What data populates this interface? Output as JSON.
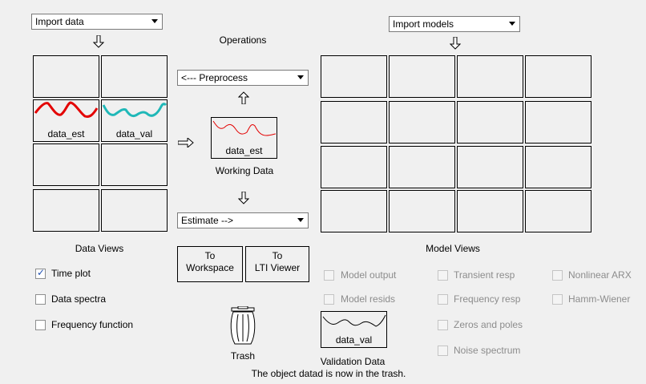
{
  "import_data": {
    "selected": "Import data"
  },
  "import_models": {
    "selected": "Import models"
  },
  "operations": {
    "title": "Operations",
    "preprocess": "<--- Preprocess",
    "estimate": "Estimate -->"
  },
  "data_boards": {
    "slot_estimation": "data_est",
    "slot_validation": "data_val",
    "caption": "Data Views"
  },
  "working_data": {
    "label": "data_est",
    "caption": "Working Data"
  },
  "buttons": {
    "to_workspace": [
      "To",
      "Workspace"
    ],
    "to_lti": [
      "To",
      "LTI Viewer"
    ]
  },
  "data_views": [
    {
      "label": "Time plot",
      "checked": true
    },
    {
      "label": "Data spectra",
      "checked": false
    },
    {
      "label": "Frequency function",
      "checked": false
    }
  ],
  "model_views": {
    "caption": "Model Views",
    "items": [
      "Model output",
      "Transient resp",
      "Nonlinear ARX",
      "Model resids",
      "Frequency resp",
      "Hamm-Wiener",
      "Zeros and poles",
      "Noise spectrum"
    ]
  },
  "trash": {
    "label": "Trash"
  },
  "validation_data": {
    "label": "data_val",
    "caption": "Validation Data"
  },
  "status": "The object datad is now in the trash.",
  "colors": {
    "estimation_curve": "#e30000",
    "validation_curve": "#20b8b8",
    "validation_data_curve": "#000000"
  }
}
